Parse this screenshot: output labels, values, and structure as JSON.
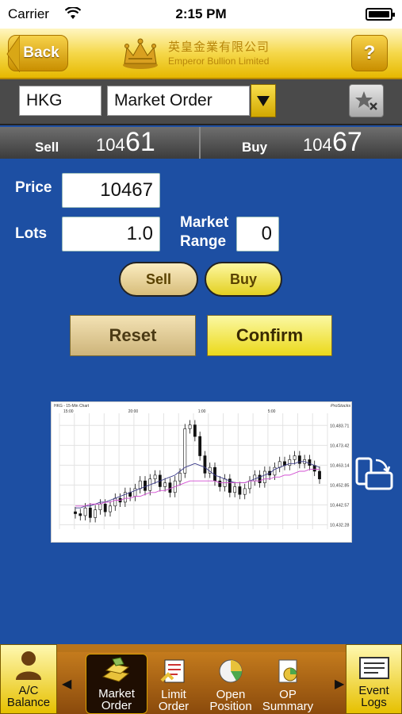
{
  "status_bar": {
    "carrier": "Carrier",
    "time": "2:15 PM"
  },
  "header": {
    "back_label": "Back",
    "logo_cn": "英皇金業有限公司",
    "logo_en": "Emperor Bullion Limited",
    "help_label": "?"
  },
  "selector": {
    "product": "HKG",
    "order_type": "Market Order"
  },
  "quote": {
    "sell_label": "Sell",
    "sell_price_prefix": "104",
    "sell_price_suffix": "61",
    "buy_label": "Buy",
    "buy_price_prefix": "104",
    "buy_price_suffix": "67"
  },
  "form": {
    "price_label": "Price",
    "price_value": "10467",
    "lots_label": "Lots",
    "lots_value": "1.0",
    "range_label_1": "Market",
    "range_label_2": "Range",
    "range_value": "0",
    "sell_label": "Sell",
    "buy_label": "Buy",
    "reset_label": "Reset",
    "confirm_label": "Confirm"
  },
  "chart_data": {
    "type": "candlestick",
    "title": "HKG - 15-Min Chart",
    "brand": "ProStocks",
    "x_ticks": [
      "15:00",
      "20:00",
      "1:00",
      "5:00"
    ],
    "y_ticks": [
      "10,483.71",
      "10,473.42",
      "10,463.14",
      "10,452.85",
      "10,442.57",
      "10,432.28"
    ],
    "ylim": [
      10430,
      10490
    ],
    "series": [
      {
        "values": [
          10438,
          10437,
          10441,
          10436,
          10440,
          10443,
          10439,
          10442,
          10446,
          10444,
          10449,
          10447,
          10451,
          10455,
          10450,
          10456,
          10458,
          10452,
          10454,
          10449,
          10455,
          10459,
          10482,
          10484,
          10478,
          10468,
          10459,
          10462,
          10455,
          10452,
          10456,
          10449,
          10452,
          10448,
          10451,
          10455,
          10458,
          10454,
          10460,
          10458,
          10462,
          10465,
          10463,
          10466,
          10468,
          10464,
          10466,
          10463,
          10460,
          10456
        ]
      },
      {
        "values": [
          10441,
          10441,
          10442,
          10442,
          10443,
          10444,
          10444,
          10445,
          10446,
          10447,
          10448,
          10449,
          10450,
          10451,
          10452,
          10453,
          10454,
          10455,
          10456,
          10457,
          10458,
          10460,
          10462,
          10463,
          10464,
          10463,
          10462,
          10460,
          10458,
          10457,
          10456,
          10455,
          10454,
          10454,
          10454,
          10455,
          10456,
          10457,
          10458,
          10459,
          10461,
          10462,
          10463,
          10464,
          10464,
          10465,
          10465,
          10464,
          10463,
          10462
        ]
      },
      {
        "values": [
          10442,
          10442,
          10442,
          10443,
          10443,
          10443,
          10444,
          10444,
          10445,
          10445,
          10446,
          10446,
          10447,
          10447,
          10448,
          10449,
          10449,
          10450,
          10450,
          10451,
          10452,
          10453,
          10454,
          10455,
          10455,
          10455,
          10455,
          10455,
          10455,
          10454,
          10454,
          10454,
          10454,
          10454,
          10454,
          10455,
          10455,
          10455,
          10456,
          10456,
          10457,
          10457,
          10458,
          10458,
          10459,
          10460,
          10460,
          10461,
          10461,
          10461
        ]
      }
    ]
  },
  "bottom_nav": {
    "left": {
      "label_1": "A/C",
      "label_2": "Balance"
    },
    "tabs": [
      {
        "label_1": "Market",
        "label_2": "Order"
      },
      {
        "label_1": "Limit",
        "label_2": "Order"
      },
      {
        "label_1": "Open",
        "label_2": "Position"
      },
      {
        "label_1": "OP",
        "label_2": "Summary"
      }
    ],
    "right": {
      "label_1": "Event",
      "label_2": "Logs"
    }
  }
}
